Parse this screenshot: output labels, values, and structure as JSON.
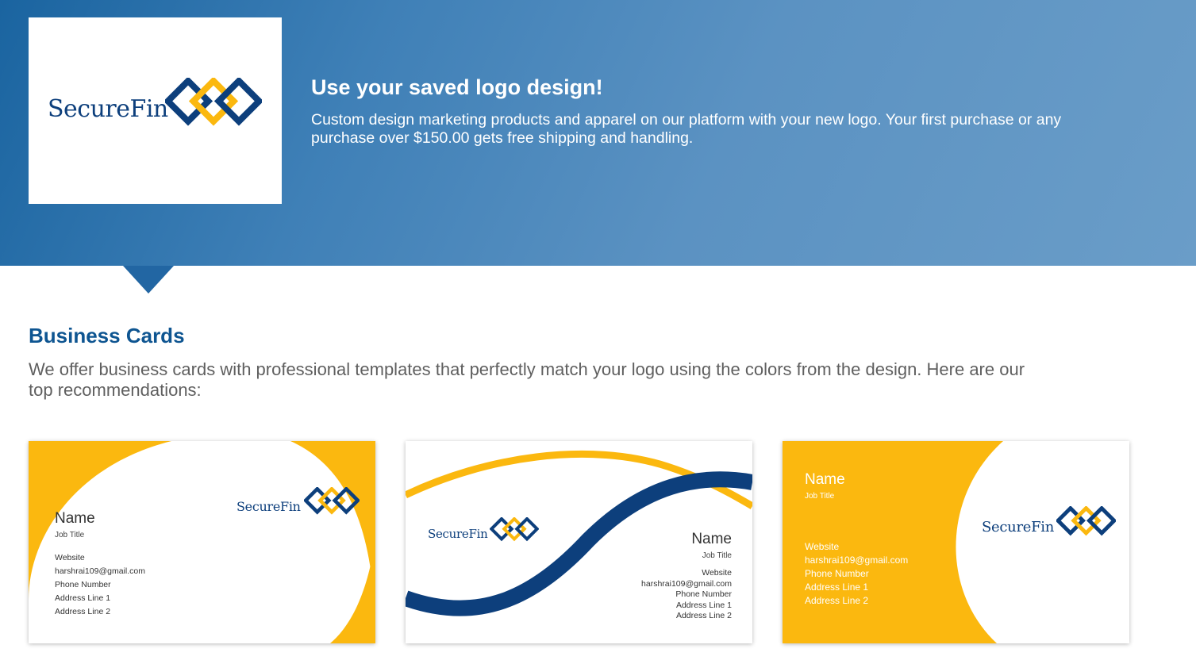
{
  "hero": {
    "logo_text": "SecureFin",
    "title": "Use your saved logo design!",
    "text": "Custom design marketing products and apparel on our platform with your new logo. Your first purchase or any purchase over $150.00 gets free shipping and handling."
  },
  "section": {
    "title": "Business Cards",
    "text": "We offer business cards with professional templates that perfectly match your logo using the colors from the design. Here are our top recommendations:"
  },
  "cards": [
    {
      "logo_text": "SecureFin",
      "name": "Name",
      "job_title": "Job Title",
      "website": "Website",
      "email": "harshrai109@gmail.com",
      "phone": "Phone Number",
      "address1": "Address Line 1",
      "address2": "Address Line 2"
    },
    {
      "logo_text": "SecureFin",
      "name": "Name",
      "job_title": "Job Title",
      "website": "Website",
      "email": "harshrai109@gmail.com",
      "phone": "Phone Number",
      "address1": "Address Line 1",
      "address2": "Address Line 2"
    },
    {
      "logo_text": "SecureFin",
      "name": "Name",
      "job_title": "Job Title",
      "website": "Website",
      "email": "harshrai109@gmail.com",
      "phone": "Phone Number",
      "address1": "Address Line 1",
      "address2": "Address Line 2"
    }
  ],
  "colors": {
    "brand_blue": "#0d3f7c",
    "brand_yellow": "#fbb80f",
    "heading_blue": "#0e5591"
  },
  "icons": {
    "logo_mark": "interlocking-diamonds-icon"
  }
}
